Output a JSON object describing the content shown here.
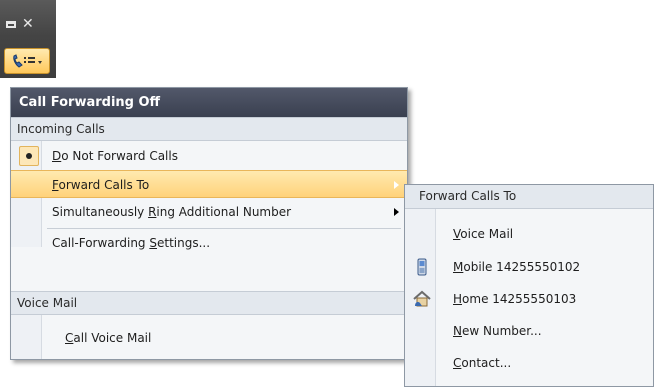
{
  "titlebar": {
    "buttons": [
      "minimize",
      "close"
    ]
  },
  "toolbar": {
    "call_forward_icon": "call-forward-phone-icon"
  },
  "menu": {
    "header": "Call Forwarding Off",
    "incoming_section": "Incoming Calls",
    "items": {
      "do_not_forward": {
        "accel": "D",
        "rest": "o Not Forward Calls"
      },
      "forward_calls_to": {
        "accel": "F",
        "rest": "orward Calls To"
      },
      "simultaneously_ring": {
        "pre": "Simultaneously ",
        "accel": "R",
        "rest": "ing Additional Number"
      },
      "settings": {
        "pre": "Call-Forwarding ",
        "accel": "S",
        "rest": "ettings..."
      }
    },
    "voicemail_section": "Voice Mail",
    "call_voicemail": {
      "accel": "C",
      "rest": "all Voice Mail"
    }
  },
  "submenu": {
    "header": "Forward Calls To",
    "items": {
      "voice_mail": {
        "accel": "V",
        "rest": "oice Mail"
      },
      "mobile": {
        "accel": "M",
        "rest": "obile 14255550102",
        "icon": "mobile-phone-icon"
      },
      "home": {
        "accel": "H",
        "rest": "ome 14255550103",
        "icon": "home-phone-icon"
      },
      "new_number": {
        "accel": "N",
        "rest": "ew Number..."
      },
      "contact": {
        "accel": "C",
        "rest": "ontact..."
      }
    }
  },
  "colors": {
    "header_bg": "#3a4050",
    "hover": "#ffd27a",
    "menu_bg": "#f4f6f8"
  }
}
